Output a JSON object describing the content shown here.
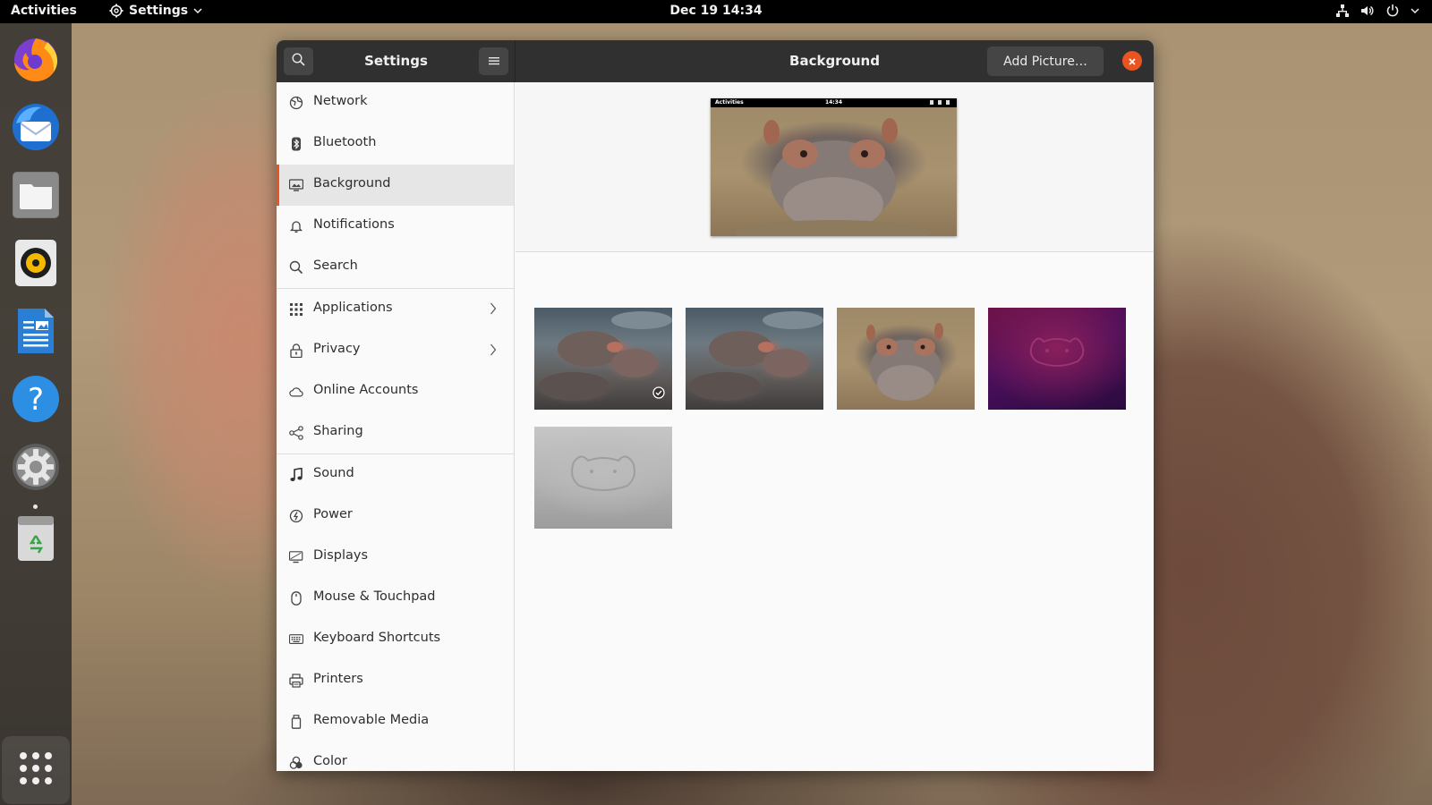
{
  "topbar": {
    "activities": "Activities",
    "app_menu_label": "Settings",
    "datetime": "Dec 19  14:34",
    "tray_icons": [
      "network-wired-icon",
      "volume-icon",
      "power-icon",
      "chevron-down-icon"
    ]
  },
  "dock": {
    "items": [
      {
        "name": "firefox-icon"
      },
      {
        "name": "thunderbird-icon"
      },
      {
        "name": "files-icon"
      },
      {
        "name": "rhythmbox-icon"
      },
      {
        "name": "libreoffice-writer-icon"
      },
      {
        "name": "help-icon"
      },
      {
        "name": "settings-icon",
        "running": true
      },
      {
        "name": "trash-icon"
      }
    ],
    "show_apps_icon": "app-grid-icon"
  },
  "window": {
    "sidebar_title": "Settings",
    "page_title": "Background",
    "add_picture_label": "Add Picture…",
    "accent": "#e95420",
    "sidebar": {
      "items": [
        {
          "label": "Network",
          "icon": "network-icon"
        },
        {
          "label": "Bluetooth",
          "icon": "bluetooth-icon"
        },
        {
          "label": "Background",
          "icon": "background-icon",
          "selected": true
        },
        {
          "label": "Notifications",
          "icon": "bell-icon"
        },
        {
          "label": "Search",
          "icon": "search-icon"
        },
        {
          "label": "Applications",
          "icon": "grid-icon",
          "chevron": true
        },
        {
          "label": "Privacy",
          "icon": "lock-icon",
          "chevron": true
        },
        {
          "label": "Online Accounts",
          "icon": "cloud-icon"
        },
        {
          "label": "Sharing",
          "icon": "share-icon"
        },
        {
          "label": "Sound",
          "icon": "music-note-icon"
        },
        {
          "label": "Power",
          "icon": "power-icon"
        },
        {
          "label": "Displays",
          "icon": "display-icon"
        },
        {
          "label": "Mouse & Touchpad",
          "icon": "mouse-icon"
        },
        {
          "label": "Keyboard Shortcuts",
          "icon": "keyboard-icon"
        },
        {
          "label": "Printers",
          "icon": "printer-icon"
        },
        {
          "label": "Removable Media",
          "icon": "removable-media-icon"
        },
        {
          "label": "Color",
          "icon": "color-icon"
        }
      ]
    },
    "preview": {
      "activities": "Activities",
      "time": "14:34"
    },
    "wallpapers": [
      {
        "style": "hippo-group",
        "selected": true
      },
      {
        "style": "hippo-group"
      },
      {
        "style": "hippo-water"
      },
      {
        "style": "hippo-purple"
      },
      {
        "style": "hippo-grey"
      }
    ]
  }
}
